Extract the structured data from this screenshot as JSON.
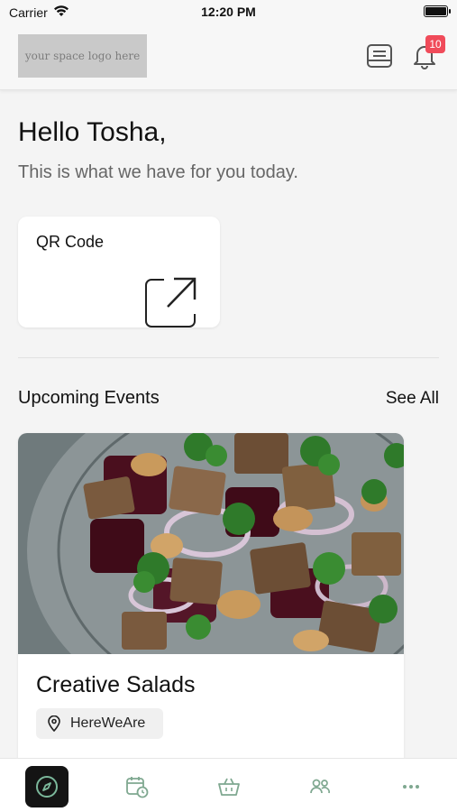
{
  "status_bar": {
    "carrier": "Carrier",
    "time": "12:20 PM"
  },
  "header": {
    "logo_text": "your space logo here",
    "notification_count": "10"
  },
  "main": {
    "greeting": "Hello Tosha,",
    "subtitle": "This is what we have for you today.",
    "qr_card": {
      "title": "QR Code"
    },
    "upcoming": {
      "title": "Upcoming Events",
      "see_all": "See All",
      "events": [
        {
          "name": "Creative Salads",
          "location": "HereWeAre"
        }
      ]
    }
  },
  "tab_bar": {
    "items": [
      {
        "icon": "compass-icon",
        "active": true
      },
      {
        "icon": "calendar-clock-icon",
        "active": false
      },
      {
        "icon": "basket-icon",
        "active": false
      },
      {
        "icon": "people-icon",
        "active": false
      },
      {
        "icon": "more-icon",
        "active": false
      }
    ]
  },
  "colors": {
    "badge": "#f04b5a",
    "active_tab": "#141414",
    "accent_green": "#7bb89b"
  }
}
